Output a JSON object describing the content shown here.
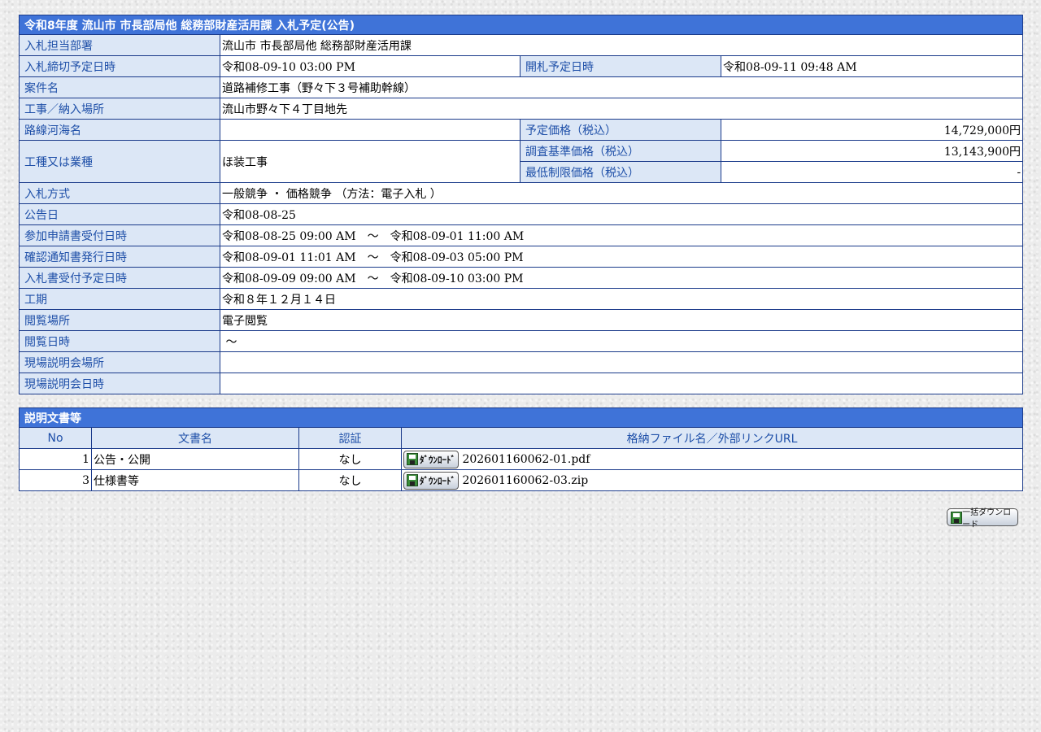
{
  "header": {
    "title": "令和8年度 流山市 市長部局他 総務部財産活用課 入札予定(公告)"
  },
  "info": {
    "dept_label": "入札担当部署",
    "dept_value": "流山市 市長部局他 総務部財産活用課",
    "deadline_label": "入札締切予定日時",
    "deadline_value": "令和08-09-10 03:00 PM",
    "opening_label": "開札予定日時",
    "opening_value": "令和08-09-11 09:48 AM",
    "project_label": "案件名",
    "project_value": "道路補修工事（野々下３号補助幹線）",
    "place_label": "工事／納入場所",
    "place_value": "流山市野々下４丁目地先",
    "route_label": "路線河海名",
    "route_value": "",
    "planned_price_label": "予定価格（税込）",
    "planned_price_value": "14,729,000円",
    "category_label": "工種又は業種",
    "category_value": "ほ装工事",
    "survey_price_label": "調査基準価格（税込）",
    "survey_price_value": "13,143,900円",
    "min_price_label": "最低制限価格（税込）",
    "min_price_value": "-",
    "method_label": "入札方式",
    "method_value": "一般競争 ・ 価格競争 （方法：電子入札 ）",
    "notice_date_label": "公告日",
    "notice_date_value": "令和08-08-25",
    "apply_label": "参加申請書受付日時",
    "apply_value": "令和08-08-25 09:00 AM　～　令和08-09-01 11:00 AM",
    "confirm_label": "確認通知書発行日時",
    "confirm_value": "令和08-09-01 11:01 AM　～　令和08-09-03 05:00 PM",
    "receipt_label": "入札書受付予定日時",
    "receipt_value": "令和08-09-09 09:00 AM　～　令和08-09-10 03:00 PM",
    "period_label": "工期",
    "period_value": "令和８年１２月１４日",
    "view_place_label": "閲覧場所",
    "view_place_value": "電子閲覧",
    "view_date_label": "閲覧日時",
    "view_date_value": " ～",
    "site_place_label": "現場説明会場所",
    "site_place_value": "",
    "site_date_label": "現場説明会日時",
    "site_date_value": ""
  },
  "docs": {
    "title": "説明文書等",
    "col_no": "No",
    "col_name": "文書名",
    "col_auth": "認証",
    "col_file": "格納ファイル名／外部リンクURL",
    "download_label": "ﾀﾞｳﾝﾛｰﾄﾞ",
    "rows": [
      {
        "no": "1",
        "name": "公告・公開",
        "auth": "なし",
        "file": "202601160062-01.pdf"
      },
      {
        "no": "3",
        "name": "仕様書等",
        "auth": "なし",
        "file": "202601160062-03.zip"
      }
    ]
  },
  "bulk_download_label": "一括ダウンロード",
  "colors": {
    "header_bg": "#3f73d8",
    "label_bg": "#dce7f6",
    "label_text": "#1e4fa8",
    "border": "#1a3a8a"
  }
}
